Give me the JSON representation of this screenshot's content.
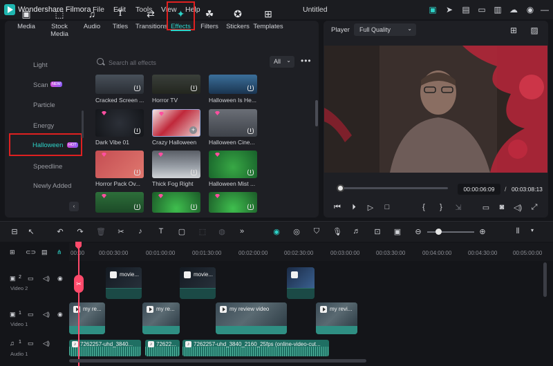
{
  "titlebar": {
    "app_name": "Wondershare Filmora",
    "menus": [
      "File",
      "Edit",
      "Tools",
      "View",
      "Help"
    ],
    "document": "Untitled"
  },
  "media_tabs": [
    {
      "label": "Media",
      "icon": "media-icon"
    },
    {
      "label": "Stock Media",
      "icon": "stock-media-icon"
    },
    {
      "label": "Audio",
      "icon": "music-note-icon"
    },
    {
      "label": "Titles",
      "icon": "text-icon"
    },
    {
      "label": "Transitions",
      "icon": "transitions-icon"
    },
    {
      "label": "Effects",
      "icon": "sparkle-icon",
      "active": true
    },
    {
      "label": "Filters",
      "icon": "filters-icon"
    },
    {
      "label": "Stickers",
      "icon": "stickers-icon"
    },
    {
      "label": "Templates",
      "icon": "templates-icon"
    }
  ],
  "categories": [
    {
      "label": "Light"
    },
    {
      "label": "Scan",
      "badge": "NEW"
    },
    {
      "label": "Particle"
    },
    {
      "label": "Energy"
    },
    {
      "label": "Halloween",
      "badge": "HOT",
      "selected": true
    },
    {
      "label": "Speedline"
    },
    {
      "label": "Newly Added"
    }
  ],
  "search": {
    "placeholder": "Search all effects"
  },
  "filter": {
    "value": "All"
  },
  "effects": [
    {
      "label": "Cracked Screen ..."
    },
    {
      "label": "Horror TV"
    },
    {
      "label": "Halloween Is He..."
    },
    {
      "label": "Dark Vibe 01"
    },
    {
      "label": "Crazy Halloween"
    },
    {
      "label": "Halloween Cine..."
    },
    {
      "label": "Horror Pack Ov..."
    },
    {
      "label": "Thick Fog Right"
    },
    {
      "label": "Halloween Mist ..."
    },
    {
      "label": ""
    },
    {
      "label": ""
    },
    {
      "label": ""
    }
  ],
  "player": {
    "label": "Player",
    "quality": "Full Quality",
    "current_time": "00:00:06:09",
    "separator": "/",
    "total_time": "00:03:08:13",
    "progress": 0.03
  },
  "timeline": {
    "ticks": [
      "00:00",
      "00:00:30:00",
      "00:01:00:00",
      "00:01:30:00",
      "00:02:00:00",
      "00:02:30:00",
      "00:03:00:00",
      "00:03:30:00",
      "00:04:00:00",
      "00:04:30:00",
      "00:05:00:00"
    ],
    "tracks": [
      {
        "label": "Video 2",
        "number": "2"
      },
      {
        "label": "Video 1",
        "number": "1"
      },
      {
        "label": "Audio 1",
        "number": "1"
      }
    ],
    "video2_clips": [
      "movie...",
      "movie...",
      ""
    ],
    "video1_clips": [
      "my re...",
      "my re...",
      "my review video",
      "my revi..."
    ],
    "audio_clips": [
      "7262257-uhd_3840...",
      "72622...",
      "7262257-uhd_3840_2160_25fps (online-video-cut..."
    ]
  },
  "colors": {
    "accent": "#2dd3c8",
    "highlight_box": "#e02020",
    "playhead": "#ff4a6b"
  }
}
